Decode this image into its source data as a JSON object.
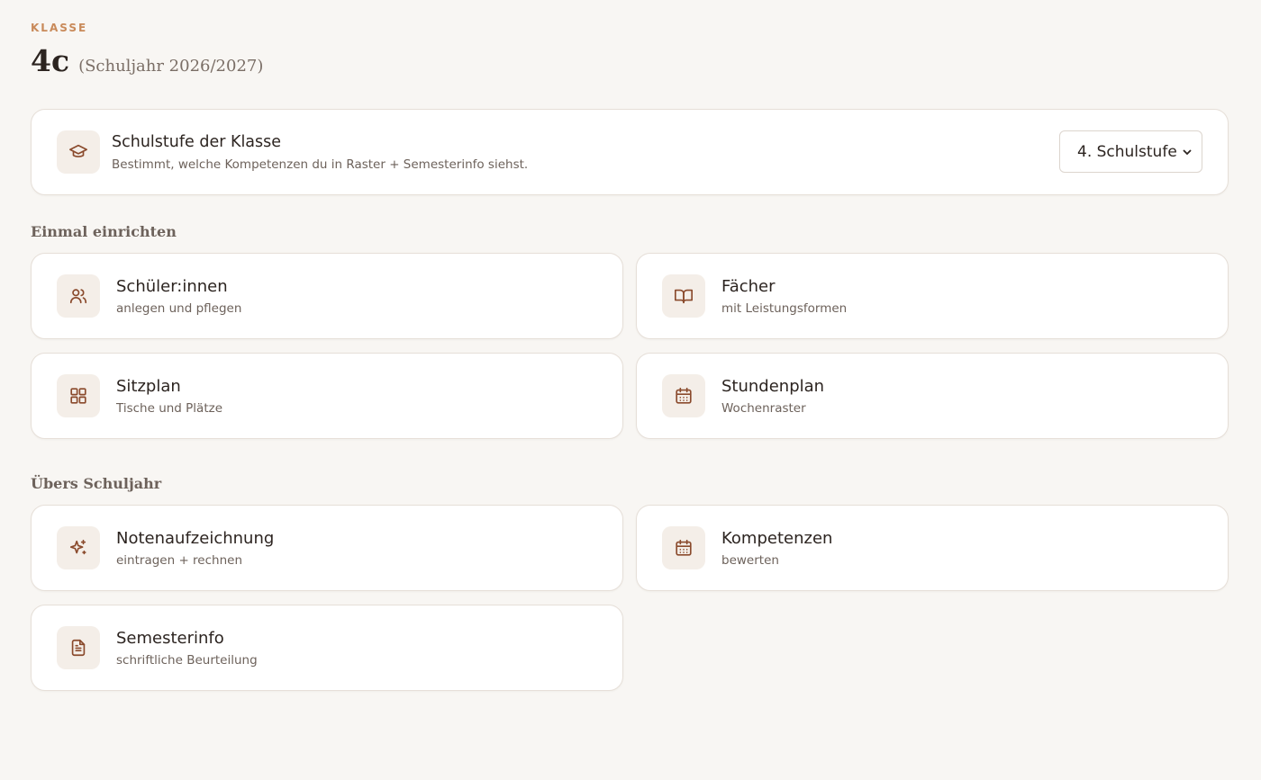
{
  "header": {
    "eyebrow": "KLASSE",
    "class_name": "4c",
    "school_year": "(Schuljahr 2026/2027)"
  },
  "grade_setting": {
    "title": "Schulstufe der Klasse",
    "subtitle": "Bestimmt, welche Kompetenzen du in Raster + Semesterinfo siehst.",
    "selected": "4. Schulstufe",
    "icon": "graduation-cap-icon"
  },
  "sections": {
    "setup": {
      "title": "Einmal einrichten",
      "items": [
        {
          "title": "Schüler:innen",
          "subtitle": "anlegen und pflegen",
          "icon": "users-icon"
        },
        {
          "title": "Fächer",
          "subtitle": "mit Leistungsformen",
          "icon": "book-open-icon"
        },
        {
          "title": "Sitzplan",
          "subtitle": "Tische und Plätze",
          "icon": "grid-icon"
        },
        {
          "title": "Stundenplan",
          "subtitle": "Wochenraster",
          "icon": "calendar-icon"
        }
      ]
    },
    "year": {
      "title": "Übers Schuljahr",
      "items": [
        {
          "title": "Notenaufzeichnung",
          "subtitle": "eintragen + rechnen",
          "icon": "sparkle-icon"
        },
        {
          "title": "Kompetenzen",
          "subtitle": "bewerten",
          "icon": "calendar-icon"
        },
        {
          "title": "Semesterinfo",
          "subtitle": "schriftliche Beurteilung",
          "icon": "document-icon"
        }
      ]
    }
  },
  "colors": {
    "background": "#f8f6f3",
    "accent": "#c98a5a",
    "icon": "#8a4a2c",
    "icon_bg": "#f4eee8"
  }
}
